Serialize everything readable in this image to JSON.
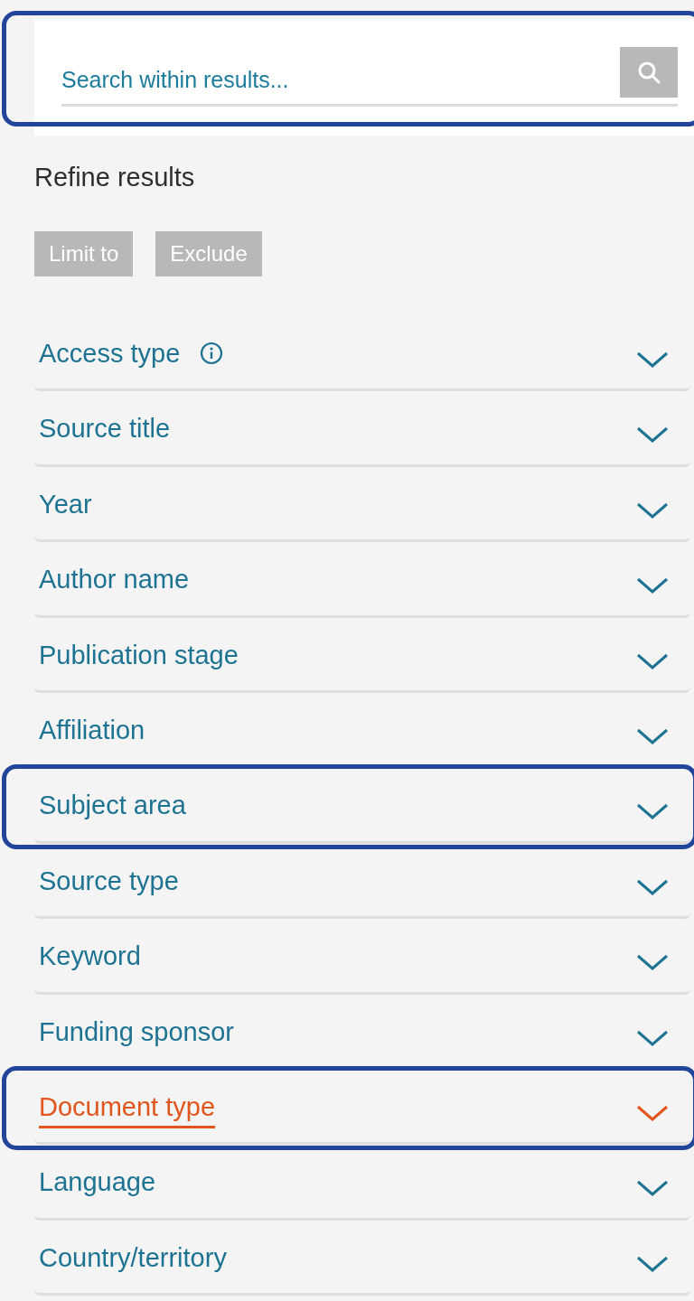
{
  "search": {
    "placeholder": "Search within results...",
    "highlighted": true
  },
  "heading": "Refine results",
  "actions": [
    {
      "label": "Limit to",
      "disabled": true
    },
    {
      "label": "Exclude",
      "disabled": true
    }
  ],
  "filters": [
    {
      "label": "Access type",
      "info": true,
      "selected": false,
      "highlighted": false
    },
    {
      "label": "Source title",
      "info": false,
      "selected": false,
      "highlighted": false
    },
    {
      "label": "Year",
      "info": false,
      "selected": false,
      "highlighted": false
    },
    {
      "label": "Author name",
      "info": false,
      "selected": false,
      "highlighted": false
    },
    {
      "label": "Publication stage",
      "info": false,
      "selected": false,
      "highlighted": false
    },
    {
      "label": "Affiliation",
      "info": false,
      "selected": false,
      "highlighted": false
    },
    {
      "label": "Subject area",
      "info": false,
      "selected": false,
      "highlighted": true
    },
    {
      "label": "Source type",
      "info": false,
      "selected": false,
      "highlighted": false
    },
    {
      "label": "Keyword",
      "info": false,
      "selected": false,
      "highlighted": false
    },
    {
      "label": "Funding sponsor",
      "info": false,
      "selected": false,
      "highlighted": false
    },
    {
      "label": "Document type",
      "info": false,
      "selected": true,
      "highlighted": true
    },
    {
      "label": "Language",
      "info": false,
      "selected": false,
      "highlighted": false
    },
    {
      "label": "Country/territory",
      "info": false,
      "selected": false,
      "highlighted": false
    }
  ]
}
